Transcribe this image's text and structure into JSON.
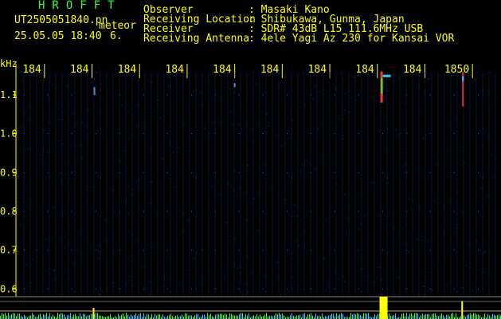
{
  "header": {
    "title": "HROFFT",
    "filename": "UT2505051840.pn",
    "meteor_label": "meteor",
    "datetime": "25.05.05 18:40",
    "meteor_count": "6."
  },
  "info": [
    {
      "label": "Observer",
      "value": ": Masaki Kano"
    },
    {
      "label": "Receiving Location",
      "value": ": Shibukawa, Gunma, Japan"
    },
    {
      "label": "Receiver",
      "value": ": SDR# 43dB L15 111.6MHz USB"
    },
    {
      "label": "Receiving Antenna",
      "value": ": 4ele Yagi Az 230 for Kansai VOR"
    }
  ],
  "colors": {
    "text": "#ffff00",
    "title": "#33ff33",
    "background": "#000000",
    "grid": "#1a2a88"
  },
  "chart_data": {
    "type": "heatmap",
    "y_unit": "kHz",
    "x_ticks": [
      "184",
      "184",
      "184",
      "184",
      "184",
      "184",
      "184",
      "184",
      "184",
      "1850"
    ],
    "y_ticks": [
      "1.1",
      "1.0",
      "0.9",
      "0.8",
      "0.7",
      "0.6"
    ],
    "y_tick_values": [
      1.1,
      1.0,
      0.9,
      0.8,
      0.7,
      0.6
    ],
    "ylim": [
      0.58,
      1.18
    ],
    "x_tick_minutes": [
      0,
      1,
      2,
      3,
      4,
      5,
      6,
      7,
      8,
      9
    ],
    "xlim": [
      -0.6,
      9.6
    ],
    "echoes": [
      {
        "t": 1.05,
        "f_lo": 1.1,
        "f_hi": 1.12,
        "strength": "weak"
      },
      {
        "t": 4.0,
        "f_lo": 1.12,
        "f_hi": 1.13,
        "strength": "weak"
      },
      {
        "t": 7.08,
        "f_lo": 1.08,
        "f_hi": 1.16,
        "strength": "strong"
      },
      {
        "t": 8.8,
        "f_lo": 1.07,
        "f_hi": 1.16,
        "strength": "medium"
      }
    ],
    "spectrum_peaks": [
      {
        "t": 1.05,
        "level": 0.5
      },
      {
        "t": 7.08,
        "level": 1.0
      },
      {
        "t": 8.8,
        "level": 0.8
      }
    ]
  }
}
